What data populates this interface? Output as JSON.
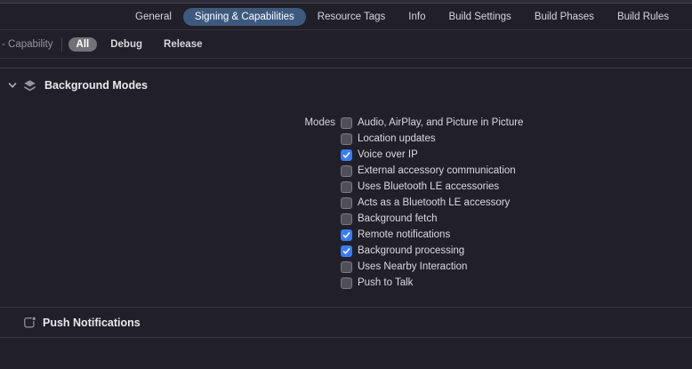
{
  "tabs": {
    "items": [
      {
        "label": "General",
        "selected": false
      },
      {
        "label": "Signing & Capabilities",
        "selected": true
      },
      {
        "label": "Resource Tags",
        "selected": false
      },
      {
        "label": "Info",
        "selected": false
      },
      {
        "label": "Build Settings",
        "selected": false
      },
      {
        "label": "Build Phases",
        "selected": false
      },
      {
        "label": "Build Rules",
        "selected": false
      }
    ]
  },
  "filter_bar": {
    "capability_label": "- Capability",
    "scopes": [
      {
        "label": "All",
        "selected": true
      },
      {
        "label": "Debug",
        "selected": false
      },
      {
        "label": "Release",
        "selected": false
      }
    ]
  },
  "sections": [
    {
      "title": "Background Modes",
      "icon": "background-modes-icon",
      "expanded": true
    },
    {
      "title": "Push Notifications",
      "icon": "push-notifications-icon"
    }
  ],
  "background_modes": {
    "field_label": "Modes",
    "modes": [
      {
        "label": "Audio, AirPlay, and Picture in Picture",
        "checked": false
      },
      {
        "label": "Location updates",
        "checked": false
      },
      {
        "label": "Voice over IP",
        "checked": true
      },
      {
        "label": "External accessory communication",
        "checked": false
      },
      {
        "label": "Uses Bluetooth LE accessories",
        "checked": false
      },
      {
        "label": "Acts as a Bluetooth LE accessory",
        "checked": false
      },
      {
        "label": "Background fetch",
        "checked": false
      },
      {
        "label": "Remote notifications",
        "checked": true
      },
      {
        "label": "Background processing",
        "checked": true
      },
      {
        "label": "Uses Nearby Interaction",
        "checked": false
      },
      {
        "label": "Push to Talk",
        "checked": false
      }
    ]
  },
  "colors": {
    "background": "#211f28",
    "selected_tab_bg": "#3d5a7e",
    "selected_scope_bg": "#747279",
    "checkbox_checked": "#3a7bf6",
    "divider": "#3b3846",
    "icon_gray": "#97959d"
  }
}
